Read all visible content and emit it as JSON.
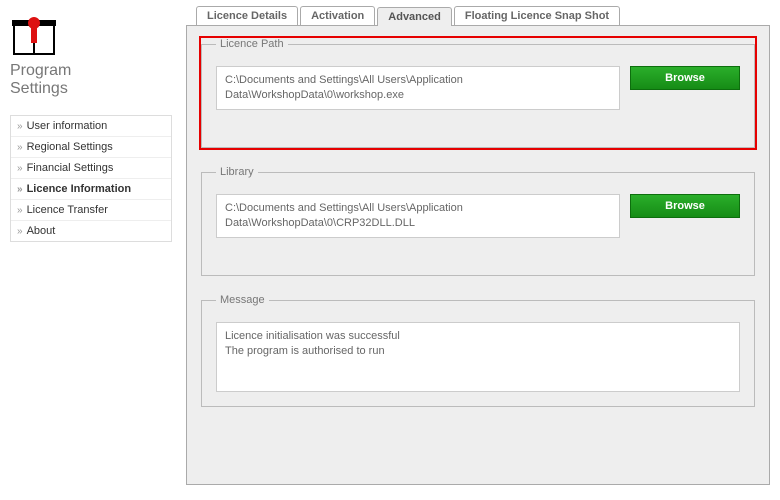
{
  "app": {
    "title_line1": "Program",
    "title_line2": "Settings"
  },
  "sidebar": {
    "items": [
      {
        "label": "User information"
      },
      {
        "label": "Regional Settings"
      },
      {
        "label": "Financial Settings"
      },
      {
        "label": "Licence Information"
      },
      {
        "label": "Licence Transfer"
      },
      {
        "label": "About"
      }
    ]
  },
  "tabs": [
    {
      "label": "Licence Details"
    },
    {
      "label": "Activation"
    },
    {
      "label": "Advanced"
    },
    {
      "label": "Floating Licence Snap Shot"
    }
  ],
  "groups": {
    "licence_path": {
      "legend": "Licence Path",
      "value": "C:\\Documents and Settings\\All Users\\Application Data\\WorkshopData\\0\\workshop.exe",
      "button": "Browse"
    },
    "library": {
      "legend": "Library",
      "value": "C:\\Documents and Settings\\All Users\\Application Data\\WorkshopData\\0\\CRP32DLL.DLL",
      "button": "Browse"
    },
    "message": {
      "legend": "Message",
      "value": "Licence initialisation was successful\nThe program is authorised to run"
    }
  },
  "colors": {
    "button_bg": "#1f9a1f",
    "highlight": "#e60000"
  }
}
